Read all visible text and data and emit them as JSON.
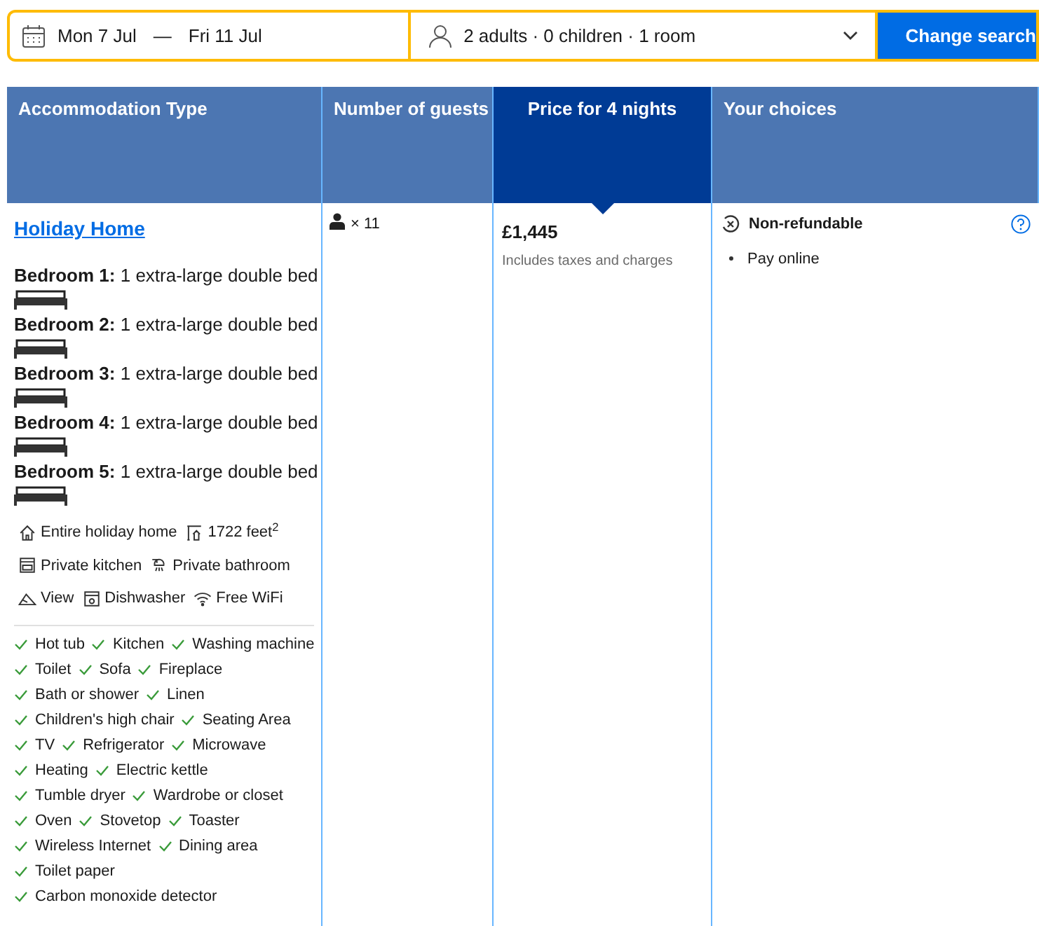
{
  "search_bar": {
    "dates": {
      "check_in": "Mon 7 Jul",
      "separator": "—",
      "check_out": "Fri 11 Jul"
    },
    "occupancy": "2 adults · 0 children · 1 room",
    "button": "Change search"
  },
  "table": {
    "columns": [
      {
        "label": "Accommodation Type",
        "selected": false
      },
      {
        "label": "Number of guests",
        "selected": false
      },
      {
        "label": "Price for 4 nights",
        "selected": true
      },
      {
        "label": "Your choices",
        "selected": false
      }
    ],
    "row": {
      "room_name": "Holiday Home",
      "bedrooms": [
        {
          "label": "Bedroom 1:",
          "beds": "1 extra-large double bed"
        },
        {
          "label": "Bedroom 2:",
          "beds": "1 extra-large double bed"
        },
        {
          "label": "Bedroom 3:",
          "beds": "1 extra-large double bed"
        },
        {
          "label": "Bedroom 4:",
          "beds": "1 extra-large double bed"
        },
        {
          "label": "Bedroom 5:",
          "beds": "1 extra-large double bed"
        }
      ],
      "facility_rows": [
        [
          {
            "kind": "home",
            "label": "Entire holiday home"
          },
          {
            "kind": "size",
            "label": "1722 feet$^{2}$"
          }
        ],
        [
          {
            "kind": "kitchen",
            "label": "Private kitchen"
          },
          {
            "kind": "bathroom",
            "label": "Private bathroom"
          }
        ],
        [
          {
            "kind": "view",
            "label": "View"
          },
          {
            "kind": "dishwasher",
            "label": "Dishwasher"
          },
          {
            "kind": "wifi",
            "label": "Free WiFi"
          }
        ]
      ],
      "amenity_rows": [
        [
          "Hot tub",
          "Kitchen",
          "Washing machine"
        ],
        [
          "Toilet",
          "Sofa",
          "Fireplace"
        ],
        [
          "Bath or shower",
          "Linen"
        ],
        [
          "Children's high chair",
          "Seating Area"
        ],
        [
          "TV",
          "Refrigerator",
          "Microwave"
        ],
        [
          "Heating",
          "Electric kettle"
        ],
        [
          "Tumble dryer",
          "Wardrobe or closet"
        ],
        [
          "Oven",
          "Stovetop",
          "Toaster"
        ],
        [
          "Wireless Internet",
          "Dining area"
        ],
        [
          "Toilet paper"
        ],
        [
          "Carbon monoxide detector"
        ]
      ],
      "guests": "× 11",
      "price": "£1,445",
      "price_note": "Includes taxes and charges",
      "policy": "Non-refundable",
      "choices": [
        "Pay online"
      ]
    }
  }
}
